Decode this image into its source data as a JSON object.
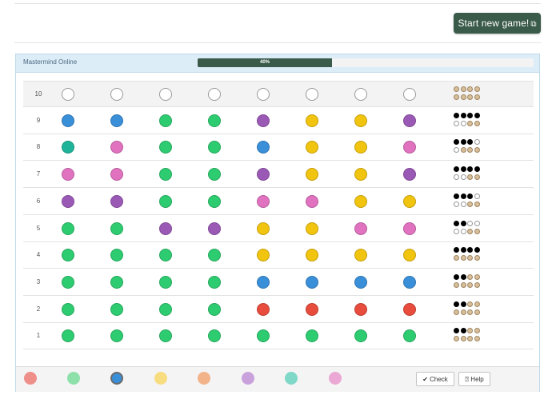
{
  "header": {
    "new_game_label": "Start new game!",
    "new_game_icon": "new-game-icon"
  },
  "panel": {
    "title": "Mastermind Online",
    "progress_label": "40%",
    "progress_fraction": 0.4
  },
  "colors": {
    "blue": "#3a8fd9",
    "green": "#2ecc71",
    "teal": "#1fb49a",
    "pink": "#e072bf",
    "purple": "#9b59b6",
    "yellow": "#f1c40f",
    "red": "#e74c3c"
  },
  "board": {
    "rows": [
      {
        "number": "10",
        "pegs": [
          "empty",
          "empty",
          "empty",
          "empty",
          "empty",
          "empty",
          "empty",
          "empty"
        ],
        "feedback": [
          "e",
          "e",
          "e",
          "e",
          "e",
          "e",
          "e",
          "e"
        ]
      },
      {
        "number": "9",
        "pegs": [
          "blue",
          "blue",
          "green",
          "green",
          "purple",
          "yellow",
          "yellow",
          "purple"
        ],
        "feedback": [
          "b",
          "b",
          "b",
          "b",
          "w",
          "w",
          "e",
          "e"
        ]
      },
      {
        "number": "8",
        "pegs": [
          "teal",
          "pink",
          "green",
          "green",
          "blue",
          "yellow",
          "yellow",
          "pink"
        ],
        "feedback": [
          "b",
          "b",
          "b",
          "w",
          "w",
          "e",
          "e",
          "e"
        ]
      },
      {
        "number": "7",
        "pegs": [
          "pink",
          "pink",
          "green",
          "green",
          "purple",
          "yellow",
          "yellow",
          "purple"
        ],
        "feedback": [
          "b",
          "b",
          "b",
          "b",
          "w",
          "w",
          "e",
          "e"
        ]
      },
      {
        "number": "6",
        "pegs": [
          "purple",
          "purple",
          "green",
          "green",
          "pink",
          "pink",
          "yellow",
          "yellow"
        ],
        "feedback": [
          "b",
          "b",
          "b",
          "w",
          "w",
          "w",
          "e",
          "e"
        ]
      },
      {
        "number": "5",
        "pegs": [
          "green",
          "green",
          "purple",
          "purple",
          "yellow",
          "yellow",
          "pink",
          "pink"
        ],
        "feedback": [
          "b",
          "b",
          "w",
          "w",
          "w",
          "w",
          "e",
          "e"
        ]
      },
      {
        "number": "4",
        "pegs": [
          "green",
          "green",
          "green",
          "green",
          "yellow",
          "yellow",
          "yellow",
          "yellow"
        ],
        "feedback": [
          "b",
          "b",
          "b",
          "b",
          "e",
          "e",
          "e",
          "e"
        ]
      },
      {
        "number": "3",
        "pegs": [
          "green",
          "green",
          "green",
          "green",
          "blue",
          "blue",
          "blue",
          "blue"
        ],
        "feedback": [
          "b",
          "b",
          "e",
          "e",
          "e",
          "e",
          "e",
          "e"
        ]
      },
      {
        "number": "2",
        "pegs": [
          "green",
          "green",
          "green",
          "green",
          "red",
          "red",
          "red",
          "red"
        ],
        "feedback": [
          "b",
          "b",
          "e",
          "e",
          "e",
          "e",
          "e",
          "e"
        ]
      },
      {
        "number": "1",
        "pegs": [
          "green",
          "green",
          "green",
          "green",
          "green",
          "green",
          "green",
          "green"
        ],
        "feedback": [
          "b",
          "b",
          "e",
          "e",
          "e",
          "e",
          "e",
          "e"
        ]
      }
    ]
  },
  "palette": {
    "colors": [
      "#ef8f8a",
      "#8de0aa",
      "#3a8fd9",
      "#f7dc80",
      "#f2b38a",
      "#c9a2dc",
      "#7fd8c8",
      "#eba8d4"
    ],
    "selected_index": 2
  },
  "actions": {
    "check_label": "Check",
    "check_icon": "checkmark-icon",
    "help_label": "Help",
    "help_icon": "question-icon"
  }
}
